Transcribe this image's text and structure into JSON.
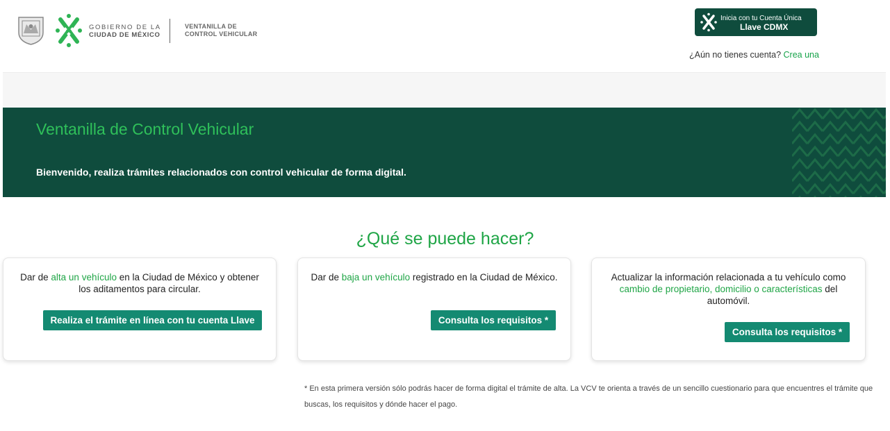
{
  "header": {
    "gov_line1": "GOBIERNO DE LA",
    "gov_line2": "CIUDAD DE MÉXICO",
    "vcv_line1": "VENTANILLA DE",
    "vcv_line2": "CONTROL VEHICULAR",
    "login_line1": "Inicia con tu Cuenta Única",
    "login_line2": "Llave CDMX",
    "signup_prompt": "¿Aún no tienes cuenta?",
    "signup_link": "Crea una"
  },
  "hero": {
    "title": "Ventanilla de Control Vehicular",
    "subtitle": "Bienvenido, realiza trámites relacionados con control vehicular de forma digital."
  },
  "section": {
    "title": "¿Qué se puede hacer?"
  },
  "cards": [
    {
      "pre": "Dar de ",
      "highlight": "alta un vehículo",
      "post": " en la Ciudad de México y obtener los aditamentos para circular.",
      "button": "Realiza el trámite en línea con tu cuenta Llave"
    },
    {
      "pre": "Dar de ",
      "highlight": "baja un vehículo",
      "post": " registrado en la Ciudad de México.",
      "button": "Consulta los requisitos *"
    },
    {
      "pre": "Actualizar la información relacionada a tu vehículo como ",
      "highlight": "cambio de propietario, domicilio o características",
      "post": " del automóvil.",
      "button": "Consulta los requisitos *"
    }
  ],
  "footnote": "* En esta primera versión sólo podrás hacer de forma digital el trámite de alta. La VCV te orienta a través de un sencillo cuestionario para que encuentres el trámite que buscas, los requisitos y dónde hacer el pago.",
  "colors": {
    "brand_dark": "#0f4c3d",
    "brand_green": "#1fa546",
    "button": "#148a72"
  }
}
